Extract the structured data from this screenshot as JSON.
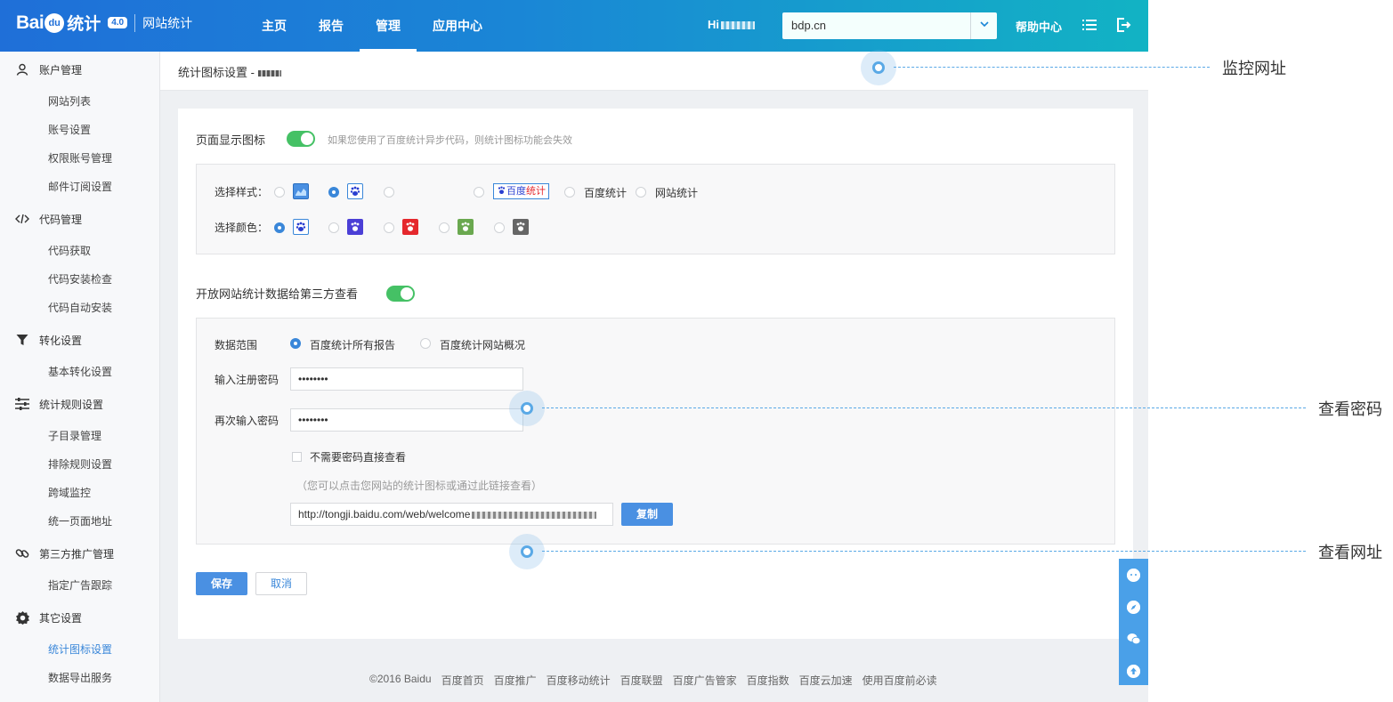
{
  "header": {
    "logo_bai": "Bai",
    "logo_du": "du",
    "logo_tongji": "统计",
    "logo_version": "4.0",
    "logo_subtitle": "网站统计",
    "nav": [
      "主页",
      "报告",
      "管理",
      "应用中心"
    ],
    "active_nav": "管理",
    "greeting": "Hi",
    "site_value": "bdp.cn",
    "help_label": "帮助中心"
  },
  "sidebar": {
    "groups": [
      {
        "label": "账户管理",
        "icon": "user-icon",
        "items": [
          "网站列表",
          "账号设置",
          "权限账号管理",
          "邮件订阅设置"
        ]
      },
      {
        "label": "代码管理",
        "icon": "code-icon",
        "items": [
          "代码获取",
          "代码安装检查",
          "代码自动安装"
        ]
      },
      {
        "label": "转化设置",
        "icon": "funnel-icon",
        "items": [
          "基本转化设置"
        ]
      },
      {
        "label": "统计规则设置",
        "icon": "sliders-icon",
        "items": [
          "子目录管理",
          "排除规则设置",
          "跨域监控",
          "统一页面地址"
        ]
      },
      {
        "label": "第三方推广管理",
        "icon": "link-icon",
        "items": [
          "指定广告跟踪"
        ]
      },
      {
        "label": "其它设置",
        "icon": "gear-icon",
        "items": [
          "统计图标设置",
          "数据导出服务"
        ]
      }
    ],
    "active_item": "统计图标设置"
  },
  "breadcrumb": {
    "title": "统计图标设置 -"
  },
  "icon_section": {
    "label": "页面显示图标",
    "toggle_on": true,
    "hint": "如果您使用了百度统计异步代码，则统计图标功能会失效",
    "style_label": "选择样式：",
    "style_badge_a": "百度",
    "style_badge_b": "统计",
    "style_text1": "百度统计",
    "style_text2": "网站统计",
    "color_label": "选择颜色：",
    "colors": [
      "#ffffff",
      "#4b3fd6",
      "#e5282d",
      "#6aa84f",
      "#666666"
    ]
  },
  "share_section": {
    "label": "开放网站统计数据给第三方查看",
    "toggle_on": true,
    "range_label": "数据范围",
    "range_option1": "百度统计所有报告",
    "range_option2": "百度统计网站概况",
    "password_label": "输入注册密码",
    "password_value": "••••••••",
    "confirm_label": "再次输入密码",
    "confirm_value": "••••••••",
    "no_password_label": "不需要密码直接查看",
    "note": "（您可以点击您网站的统计图标或通过此链接查看）",
    "link_value": "http://tongji.baidu.com/web/welcome",
    "copy_label": "复制"
  },
  "actions": {
    "save_label": "保存",
    "cancel_label": "取消"
  },
  "footer": {
    "links": [
      "©2016 Baidu",
      "百度首页",
      "百度推广",
      "百度移动统计",
      "百度联盟",
      "百度广告管家",
      "百度指数",
      "百度云加速",
      "使用百度前必读"
    ]
  },
  "float_bar": {
    "icons": [
      "feedback-icon",
      "compass-icon",
      "wechat-icon",
      "back-to-top-icon"
    ]
  },
  "callouts": {
    "monitor_url": "监控网址",
    "view_password": "查看密码",
    "view_url": "查看网址"
  },
  "colors": {
    "accent": "#3a87d9",
    "toggle": "#45c165",
    "callout": "#5aa9e6"
  }
}
